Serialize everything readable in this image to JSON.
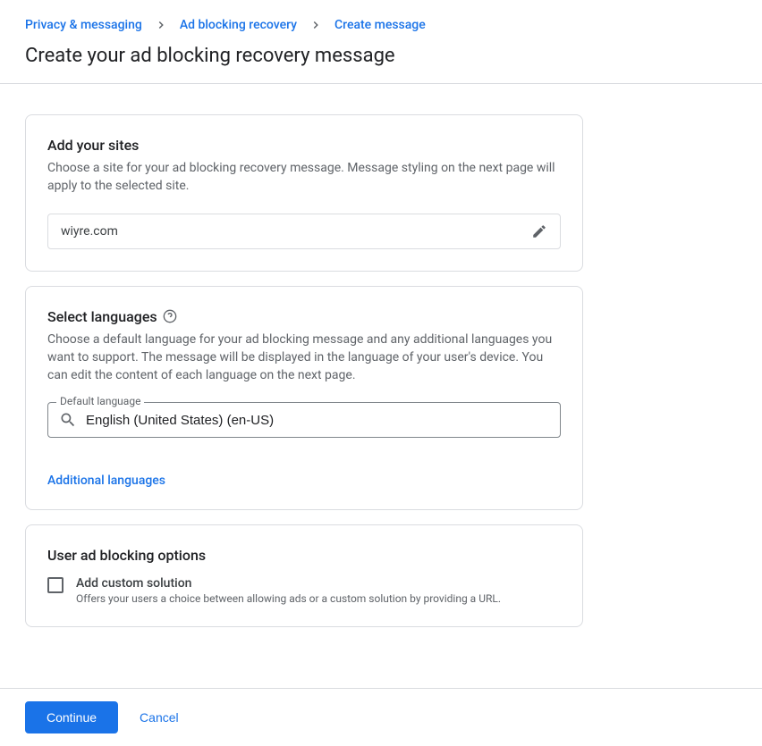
{
  "breadcrumbs": {
    "item1": "Privacy & messaging",
    "item2": "Ad blocking recovery",
    "item3": "Create message"
  },
  "page_title": "Create your ad blocking recovery message",
  "sites_card": {
    "title": "Add your sites",
    "description": "Choose a site for your ad blocking recovery message. Message styling on the next page will apply to the selected site.",
    "site_value": "wiyre.com"
  },
  "languages_card": {
    "title": "Select languages",
    "description": "Choose a default language for your ad blocking message and any additional languages you want to support. The message will be displayed in the language of your user's device. You can edit the content of each language on the next page.",
    "field_label": "Default language",
    "field_value": "English (United States) (en-US)",
    "additional_link": "Additional languages"
  },
  "options_card": {
    "title": "User ad blocking options",
    "checkbox_label": "Add custom solution",
    "checkbox_desc": "Offers your users a choice between allowing ads or a custom solution by providing a URL."
  },
  "footer": {
    "continue": "Continue",
    "cancel": "Cancel"
  }
}
